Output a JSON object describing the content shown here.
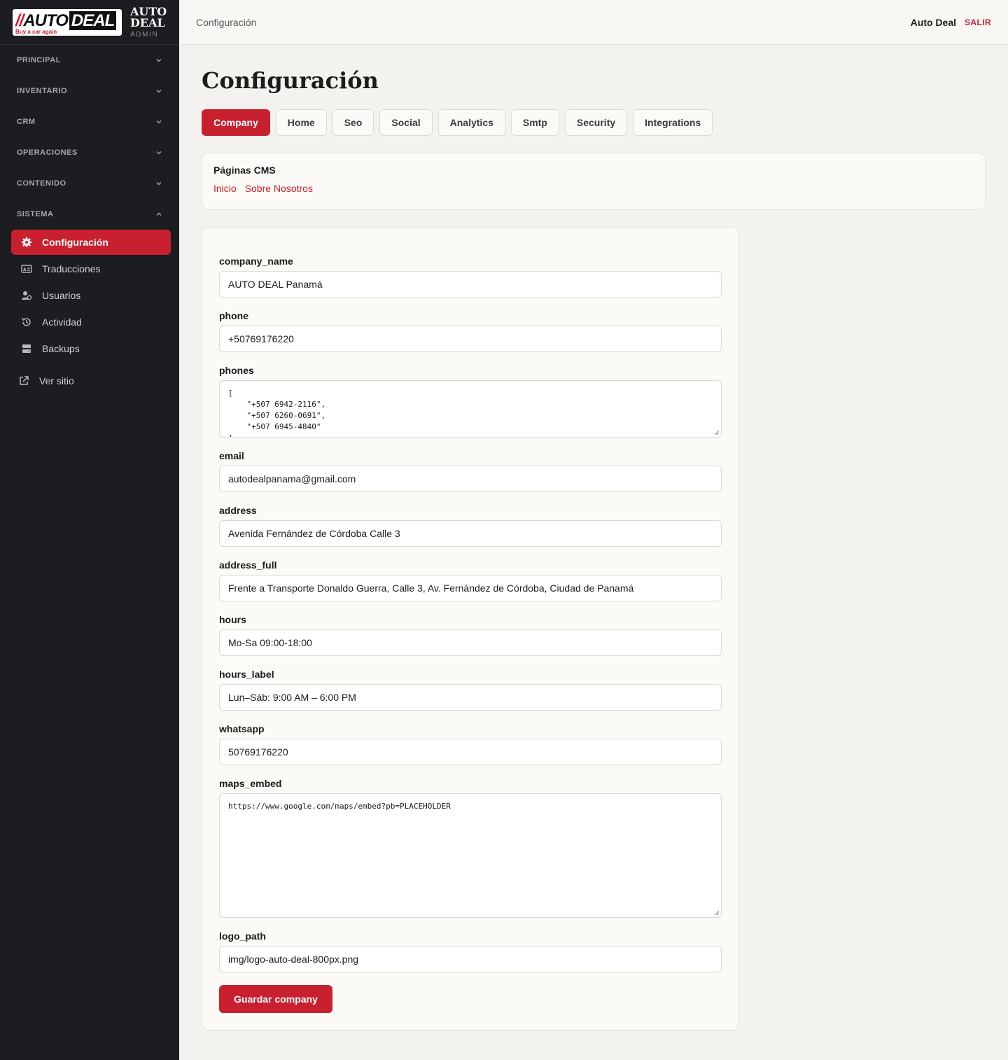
{
  "brand": {
    "logo_text_auto": "AUTO",
    "logo_text_deal": "DEAL",
    "logo_slash": "//",
    "logo_tagline": "Buy a car again",
    "title": "AUTO DEAL",
    "subtitle": "ADMIN"
  },
  "sidebar": {
    "groups": [
      {
        "label": "PRINCIPAL",
        "expanded": false
      },
      {
        "label": "INVENTARIO",
        "expanded": false
      },
      {
        "label": "CRM",
        "expanded": false
      },
      {
        "label": "OPERACIONES",
        "expanded": false
      },
      {
        "label": "CONTENIDO",
        "expanded": false
      },
      {
        "label": "SISTEMA",
        "expanded": true
      }
    ],
    "items": [
      {
        "label": "Configuración",
        "icon": "gear-icon",
        "active": true
      },
      {
        "label": "Traducciones",
        "icon": "translate-icon",
        "active": false
      },
      {
        "label": "Usuarios",
        "icon": "users-icon",
        "active": false
      },
      {
        "label": "Actividad",
        "icon": "history-icon",
        "active": false
      },
      {
        "label": "Backups",
        "icon": "server-icon",
        "active": false
      }
    ],
    "ver_sitio": "Ver sitio"
  },
  "topbar": {
    "breadcrumb": "Configuración",
    "user": "Auto Deal",
    "logout": "SALIR"
  },
  "page": {
    "title": "Configuración"
  },
  "tabs": [
    {
      "label": "Company",
      "active": true
    },
    {
      "label": "Home",
      "active": false
    },
    {
      "label": "Seo",
      "active": false
    },
    {
      "label": "Social",
      "active": false
    },
    {
      "label": "Analytics",
      "active": false
    },
    {
      "label": "Smtp",
      "active": false
    },
    {
      "label": "Security",
      "active": false
    },
    {
      "label": "Integrations",
      "active": false
    }
  ],
  "cms": {
    "title": "Páginas CMS",
    "links": [
      "Inicio",
      "Sobre Nosotros"
    ]
  },
  "form": {
    "fields": {
      "company_name": {
        "label": "company_name",
        "value": "AUTO DEAL Panamá"
      },
      "phone": {
        "label": "phone",
        "value": "+50769176220"
      },
      "phones": {
        "label": "phones",
        "value": "[\n    \"+507 6942-2116\",\n    \"+507 6260-0691\",\n    \"+507 6945-4840\"\n]"
      },
      "email": {
        "label": "email",
        "value": "autodealpanama@gmail.com"
      },
      "address": {
        "label": "address",
        "value": "Avenida Fernández de Córdoba Calle 3"
      },
      "address_full": {
        "label": "address_full",
        "value": "Frente a Transporte Donaldo Guerra, Calle 3, Av. Fernández de Córdoba, Ciudad de Panamá"
      },
      "hours": {
        "label": "hours",
        "value": "Mo-Sa 09:00-18:00"
      },
      "hours_label": {
        "label": "hours_label",
        "value": "Lun–Sáb: 9:00 AM – 6:00 PM"
      },
      "whatsapp": {
        "label": "whatsapp",
        "value": "50769176220"
      },
      "maps_embed": {
        "label": "maps_embed",
        "value": "https://www.google.com/maps/embed?pb=PLACEHOLDER"
      },
      "logo_path": {
        "label": "logo_path",
        "value": "img/logo-auto-deal-800px.png"
      }
    },
    "submit_label": "Guardar company"
  },
  "colors": {
    "accent": "#c8202f",
    "sidebar_bg": "#1c1d20",
    "page_bg": "#f3f2ee"
  }
}
